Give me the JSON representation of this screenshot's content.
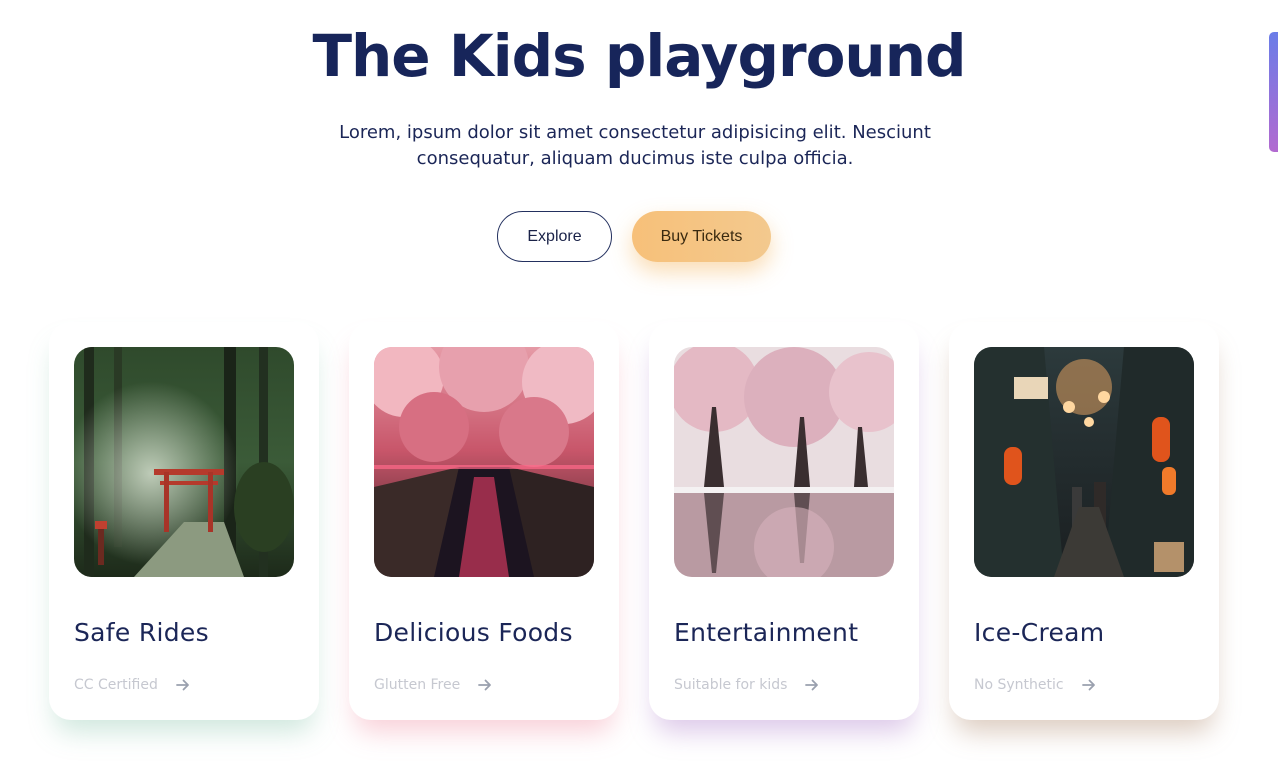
{
  "hero": {
    "title": "The Kids playground",
    "lead": "Lorem, ipsum dolor sit amet consectetur adipisicing elit. Nesciunt consequatur, aliquam ducimus iste culpa officia.",
    "explore_label": "Explore",
    "tickets_label": "Buy Tickets"
  },
  "cards": [
    {
      "title": "Safe Rides",
      "meta": "CC Certified",
      "image": "forest-torii-gate"
    },
    {
      "title": "Delicious Foods",
      "meta": "Glutten Free",
      "image": "cherry-blossom-canal"
    },
    {
      "title": "Entertainment",
      "meta": "Suitable for kids",
      "image": "cherry-trees-reflection"
    },
    {
      "title": "Ice-Cream",
      "meta": "No Synthetic",
      "image": "night-lantern-alley"
    }
  ],
  "icons": {
    "card_arrow": "arrow-right-icon"
  },
  "colors": {
    "title": "#17255a",
    "accent_button": "#f7c079",
    "meta_text": "#c6c8d0",
    "scroll_indicator": [
      "#6a7de8",
      "#b26ad0"
    ]
  }
}
